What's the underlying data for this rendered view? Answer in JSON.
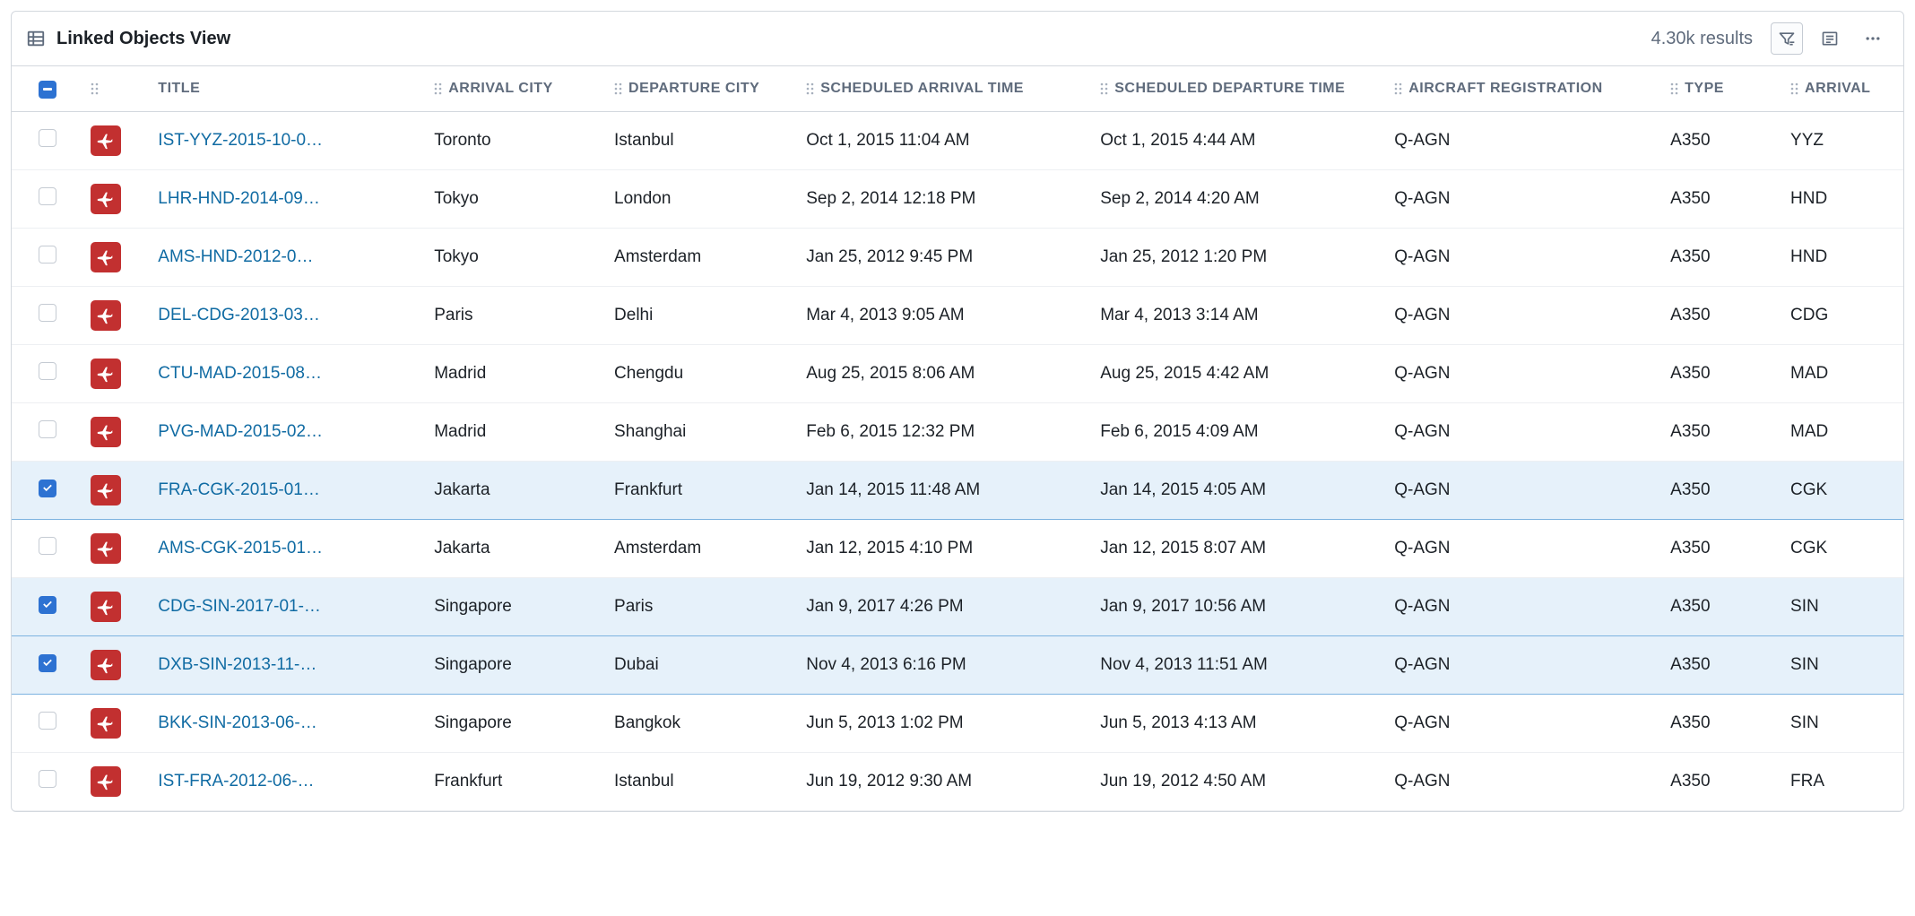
{
  "header": {
    "title": "Linked Objects View",
    "results": "4.30k results"
  },
  "columns": {
    "title": "TITLE",
    "arrival_city": "ARRIVAL CITY",
    "departure_city": "DEPARTURE CITY",
    "sched_arrival": "SCHEDULED ARRIVAL TIME",
    "sched_departure": "SCHEDULED DEPARTURE TIME",
    "aircraft_reg": "AIRCRAFT REGISTRATION",
    "type": "TYPE",
    "arrival_code": "ARRIVAL"
  },
  "rows": [
    {
      "selected": false,
      "title": "IST-YYZ-2015-10-0…",
      "arrival_city": "Toronto",
      "departure_city": "Istanbul",
      "sched_arrival": "Oct 1, 2015 11:04 AM",
      "sched_departure": "Oct 1, 2015 4:44 AM",
      "aircraft_reg": "Q-AGN",
      "type": "A350",
      "arrival_code": "YYZ"
    },
    {
      "selected": false,
      "title": "LHR-HND-2014-09…",
      "arrival_city": "Tokyo",
      "departure_city": "London",
      "sched_arrival": "Sep 2, 2014 12:18 PM",
      "sched_departure": "Sep 2, 2014 4:20 AM",
      "aircraft_reg": "Q-AGN",
      "type": "A350",
      "arrival_code": "HND"
    },
    {
      "selected": false,
      "title": "AMS-HND-2012-0…",
      "arrival_city": "Tokyo",
      "departure_city": "Amsterdam",
      "sched_arrival": "Jan 25, 2012 9:45 PM",
      "sched_departure": "Jan 25, 2012 1:20 PM",
      "aircraft_reg": "Q-AGN",
      "type": "A350",
      "arrival_code": "HND"
    },
    {
      "selected": false,
      "title": "DEL-CDG-2013-03…",
      "arrival_city": "Paris",
      "departure_city": "Delhi",
      "sched_arrival": "Mar 4, 2013 9:05 AM",
      "sched_departure": "Mar 4, 2013 3:14 AM",
      "aircraft_reg": "Q-AGN",
      "type": "A350",
      "arrival_code": "CDG"
    },
    {
      "selected": false,
      "title": "CTU-MAD-2015-08…",
      "arrival_city": "Madrid",
      "departure_city": "Chengdu",
      "sched_arrival": "Aug 25, 2015 8:06 AM",
      "sched_departure": "Aug 25, 2015 4:42 AM",
      "aircraft_reg": "Q-AGN",
      "type": "A350",
      "arrival_code": "MAD"
    },
    {
      "selected": false,
      "title": "PVG-MAD-2015-02…",
      "arrival_city": "Madrid",
      "departure_city": "Shanghai",
      "sched_arrival": "Feb 6, 2015 12:32 PM",
      "sched_departure": "Feb 6, 2015 4:09 AM",
      "aircraft_reg": "Q-AGN",
      "type": "A350",
      "arrival_code": "MAD"
    },
    {
      "selected": true,
      "title": "FRA-CGK-2015-01…",
      "arrival_city": "Jakarta",
      "departure_city": "Frankfurt",
      "sched_arrival": "Jan 14, 2015 11:48 AM",
      "sched_departure": "Jan 14, 2015 4:05 AM",
      "aircraft_reg": "Q-AGN",
      "type": "A350",
      "arrival_code": "CGK"
    },
    {
      "selected": false,
      "title": "AMS-CGK-2015-01…",
      "arrival_city": "Jakarta",
      "departure_city": "Amsterdam",
      "sched_arrival": "Jan 12, 2015 4:10 PM",
      "sched_departure": "Jan 12, 2015 8:07 AM",
      "aircraft_reg": "Q-AGN",
      "type": "A350",
      "arrival_code": "CGK"
    },
    {
      "selected": true,
      "title": "CDG-SIN-2017-01-…",
      "arrival_city": "Singapore",
      "departure_city": "Paris",
      "sched_arrival": "Jan 9, 2017 4:26 PM",
      "sched_departure": "Jan 9, 2017 10:56 AM",
      "aircraft_reg": "Q-AGN",
      "type": "A350",
      "arrival_code": "SIN"
    },
    {
      "selected": true,
      "title": "DXB-SIN-2013-11-…",
      "arrival_city": "Singapore",
      "departure_city": "Dubai",
      "sched_arrival": "Nov 4, 2013 6:16 PM",
      "sched_departure": "Nov 4, 2013 11:51 AM",
      "aircraft_reg": "Q-AGN",
      "type": "A350",
      "arrival_code": "SIN"
    },
    {
      "selected": false,
      "title": "BKK-SIN-2013-06-…",
      "arrival_city": "Singapore",
      "departure_city": "Bangkok",
      "sched_arrival": "Jun 5, 2013 1:02 PM",
      "sched_departure": "Jun 5, 2013 4:13 AM",
      "aircraft_reg": "Q-AGN",
      "type": "A350",
      "arrival_code": "SIN"
    },
    {
      "selected": false,
      "title": "IST-FRA-2012-06-…",
      "arrival_city": "Frankfurt",
      "departure_city": "Istanbul",
      "sched_arrival": "Jun 19, 2012 9:30 AM",
      "sched_departure": "Jun 19, 2012 4:50 AM",
      "aircraft_reg": "Q-AGN",
      "type": "A350",
      "arrival_code": "FRA"
    }
  ]
}
